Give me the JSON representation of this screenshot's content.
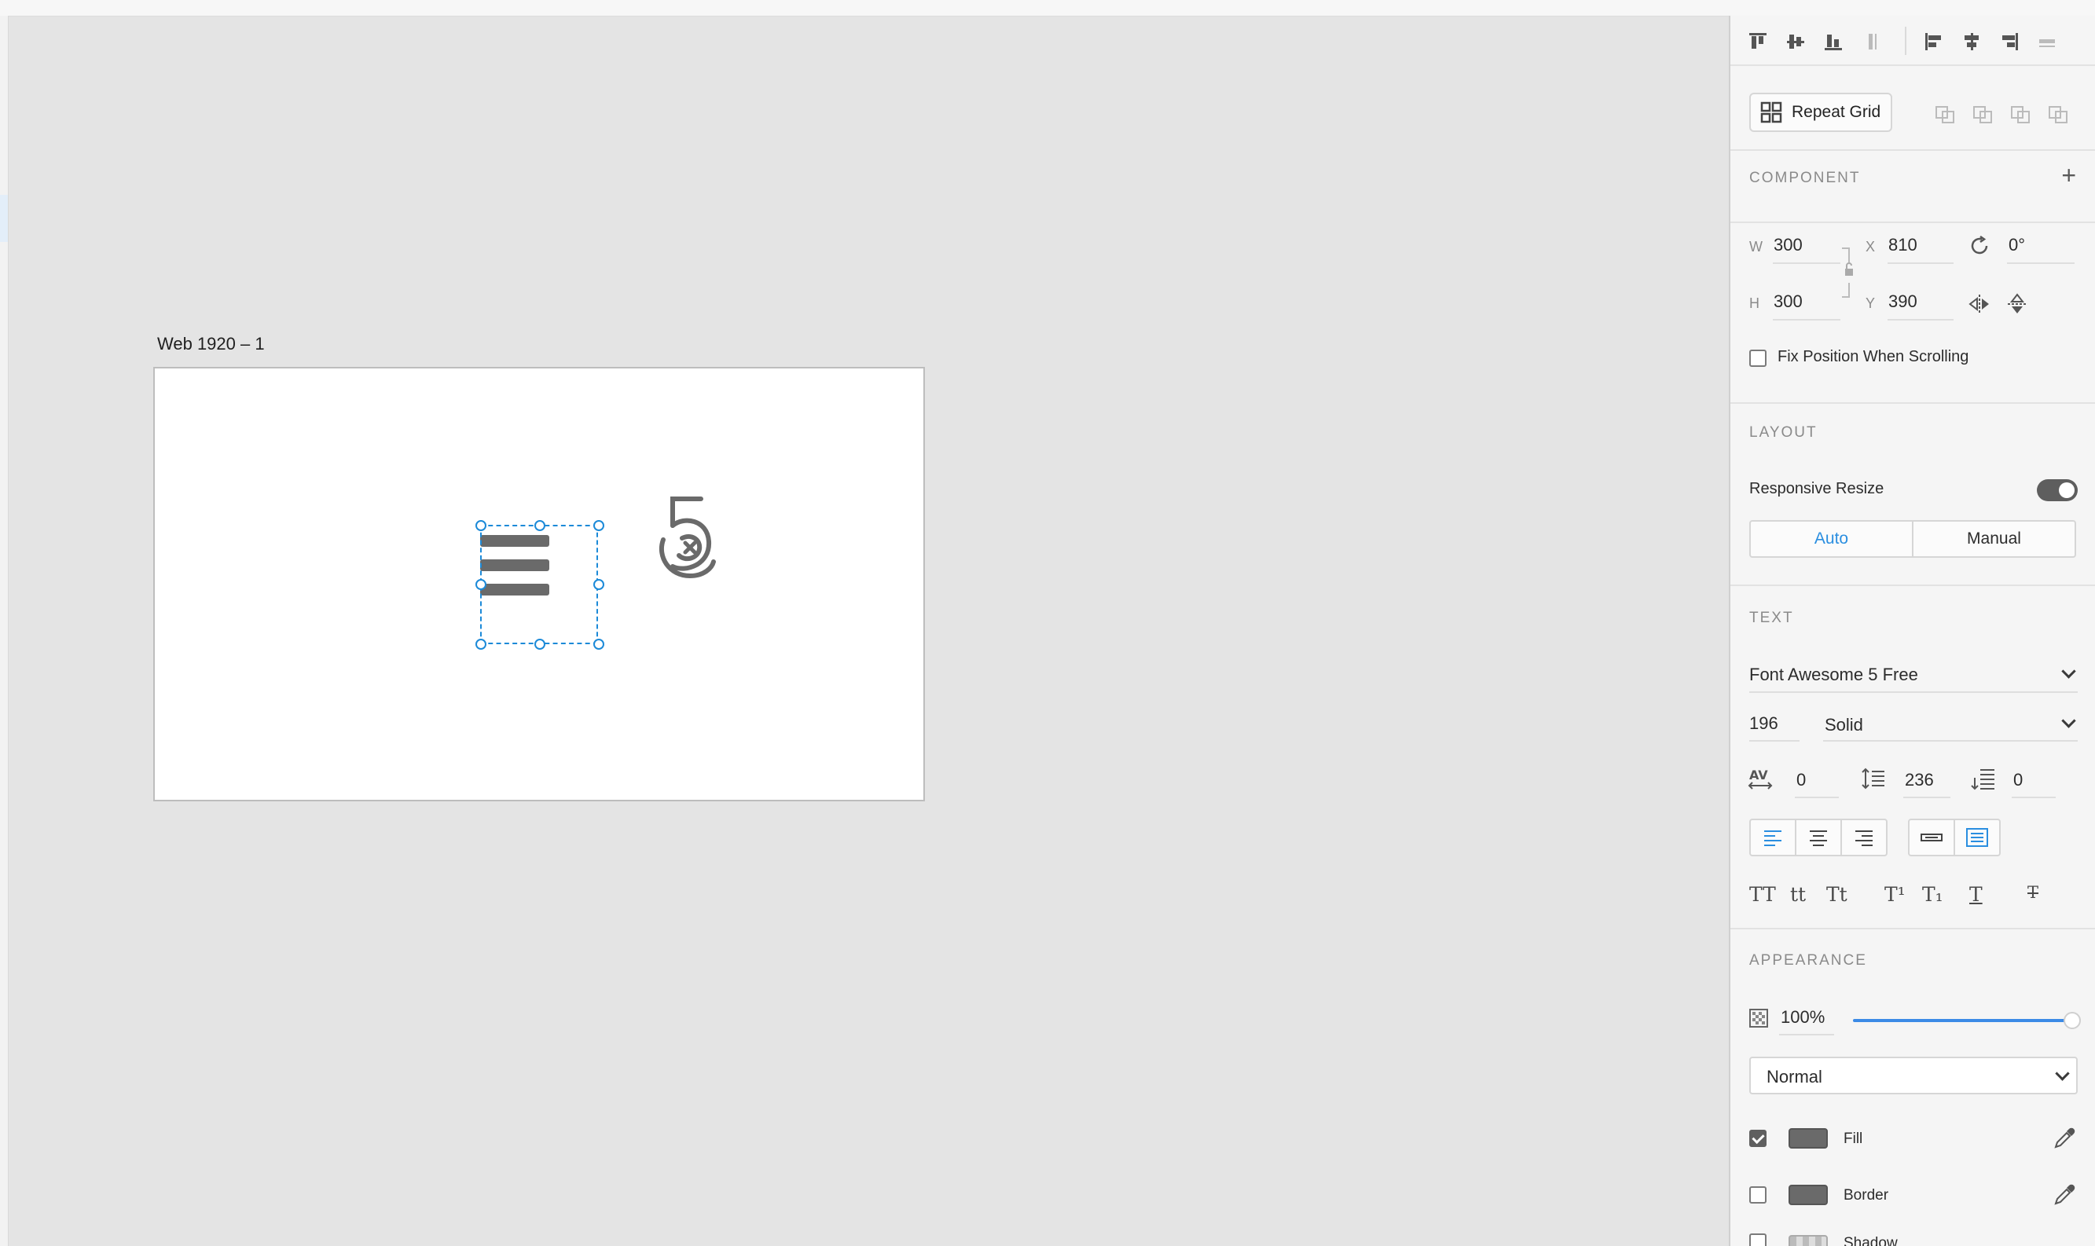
{
  "canvas": {
    "artboard_title": "Web 1920 – 1"
  },
  "inspector": {
    "repeat_grid_label": "Repeat Grid",
    "component": {
      "title": "COMPONENT",
      "add_label": "+"
    },
    "transform": {
      "w_label": "W",
      "w_value": "300",
      "x_label": "X",
      "x_value": "810",
      "h_label": "H",
      "h_value": "300",
      "y_label": "Y",
      "y_value": "390",
      "rotation_value": "0°"
    },
    "fix_position_label": "Fix Position When Scrolling",
    "layout": {
      "title": "LAYOUT",
      "responsive_resize_label": "Responsive Resize",
      "auto_label": "Auto",
      "manual_label": "Manual"
    },
    "text": {
      "title": "TEXT",
      "font_family": "Font Awesome 5 Free",
      "font_size": "196",
      "font_weight": "Solid",
      "char_spacing": "0",
      "line_spacing": "236",
      "paragraph_spacing": "0",
      "case_buttons": [
        "TT",
        "tt",
        "Tt"
      ],
      "superscript": "T¹",
      "subscript": "T₁",
      "underline": "T",
      "strikethrough": "T"
    },
    "appearance": {
      "title": "APPEARANCE",
      "opacity": "100%",
      "blend_mode": "Normal",
      "fill_label": "Fill",
      "border_label": "Border",
      "shadow_label": "Shadow",
      "fill_color": "#6a6a6a",
      "border_color": "#6a6a6a"
    },
    "accent_color": "#2a8ee0"
  }
}
